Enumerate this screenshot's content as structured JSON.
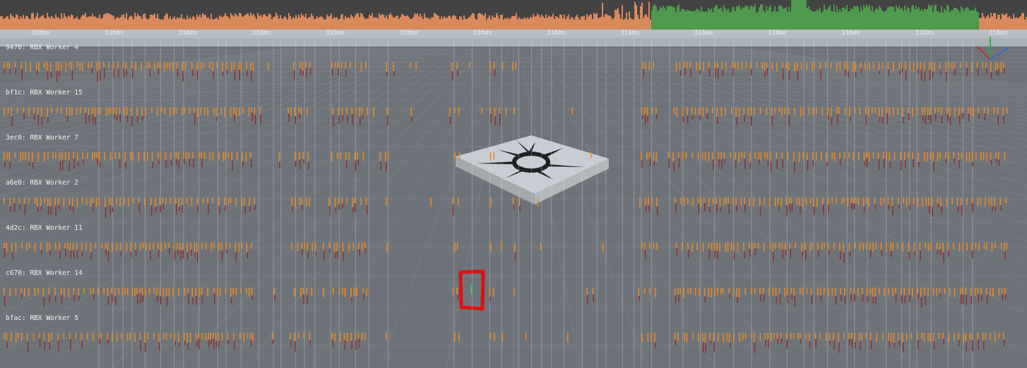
{
  "profiler": {
    "ruler_ticks": [
      "316ms",
      "316ms",
      "316ms",
      "316ms",
      "316ms",
      "316ms",
      "316ms",
      "316ms",
      "316ms",
      "316ms",
      "316ms",
      "316ms",
      "316ms",
      "316ms"
    ],
    "threads": [
      {
        "label": "9470: RBX Worker 4"
      },
      {
        "label": "bf1c: RBX Worker 15"
      },
      {
        "label": "3ec0: RBX Worker 7"
      },
      {
        "label": "a6e0: RBX Worker 2"
      },
      {
        "label": "4d2c: RBX Worker 11"
      },
      {
        "label": "c670: RBX Worker 14"
      },
      {
        "label": "bfac: RBX Worker 5"
      }
    ],
    "colors": {
      "frame_bar_cpu": "#d98a5c",
      "frame_bar_gpu": "#4e9a4e",
      "job_marker": "#e38b2a",
      "job_marker_dark": "#8b2d2d",
      "background_panel": "#434343"
    }
  },
  "viewport": {
    "axis_gizmo_labels": [
      "Y",
      "Z"
    ],
    "colors": {
      "floor": "#6e7379",
      "grid_line": "#7f848a",
      "part_top": "#c8cdd3",
      "decal": "#1e2226",
      "annotation": "#e01010"
    }
  }
}
